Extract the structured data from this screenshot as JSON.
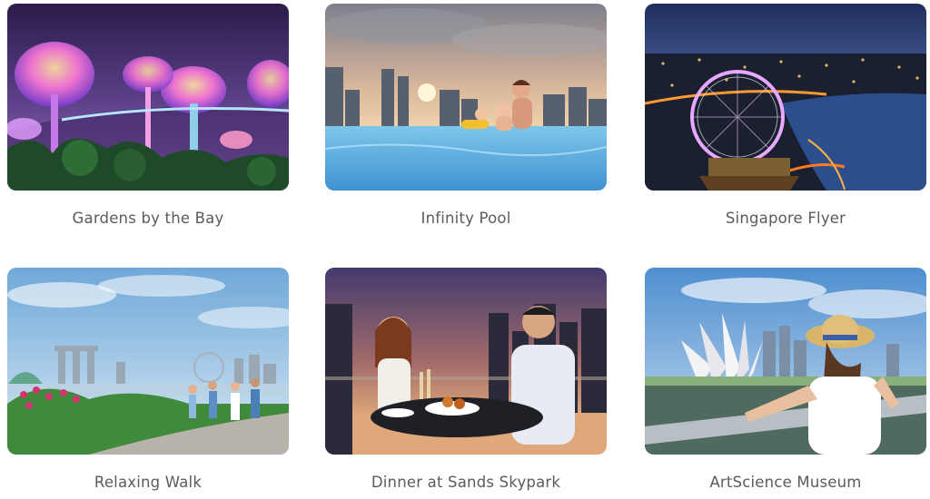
{
  "attractions": [
    {
      "caption": "Gardens by the Bay",
      "image": "supertree-grove-night-photo"
    },
    {
      "caption": "Infinity Pool",
      "image": "rooftop-infinity-pool-family-photo"
    },
    {
      "caption": "Singapore Flyer",
      "image": "observation-wheel-night-aerial-photo"
    },
    {
      "caption": "Relaxing Walk",
      "image": "family-walking-bay-skyline-photo"
    },
    {
      "caption": "Dinner at Sands Skypark",
      "image": "couple-dining-rooftop-photo"
    },
    {
      "caption": "ArtScience Museum",
      "image": "woman-straw-hat-lotus-museum-photo"
    }
  ]
}
